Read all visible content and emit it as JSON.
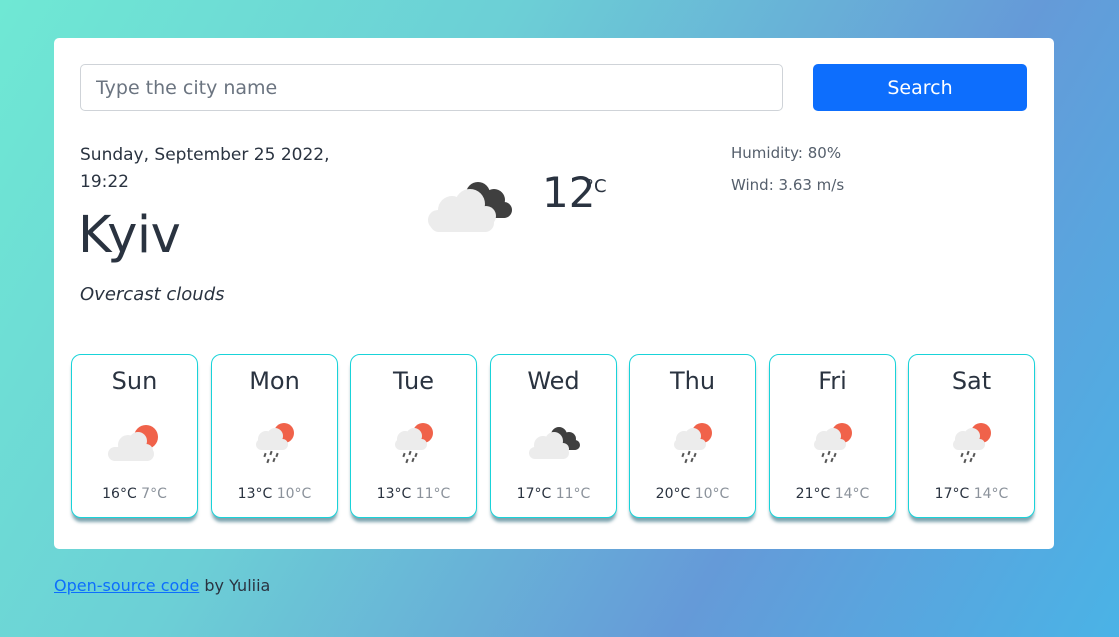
{
  "search": {
    "placeholder": "Type the city name",
    "button_label": "Search"
  },
  "current": {
    "date_line1": "Sunday, September 25 2022,",
    "date_line2": "19:22",
    "city": "Kyiv",
    "description": "Overcast clouds",
    "temperature": "12",
    "unit": "°C",
    "icon": "overcast-clouds-icon",
    "humidity": "Humidity: 80%",
    "wind": "Wind: 3.63 m/s"
  },
  "forecast": [
    {
      "day": "Sun",
      "max": "16°C",
      "min": "7°C",
      "icon": "partly-cloudy-icon"
    },
    {
      "day": "Mon",
      "max": "13°C",
      "min": "10°C",
      "icon": "rain-icon"
    },
    {
      "day": "Tue",
      "max": "13°C",
      "min": "11°C",
      "icon": "rain-icon"
    },
    {
      "day": "Wed",
      "max": "17°C",
      "min": "11°C",
      "icon": "overcast-clouds-icon"
    },
    {
      "day": "Thu",
      "max": "20°C",
      "min": "10°C",
      "icon": "rain-icon"
    },
    {
      "day": "Fri",
      "max": "21°C",
      "min": "14°C",
      "icon": "rain-icon"
    },
    {
      "day": "Sat",
      "max": "17°C",
      "min": "14°C",
      "icon": "rain-icon"
    }
  ],
  "footer": {
    "link_text": "Open-source code",
    "suffix": " by Yuliia"
  },
  "colors": {
    "accent": "#0d6efd",
    "card_border": "#19d3d9",
    "sun": "#f0624a"
  }
}
